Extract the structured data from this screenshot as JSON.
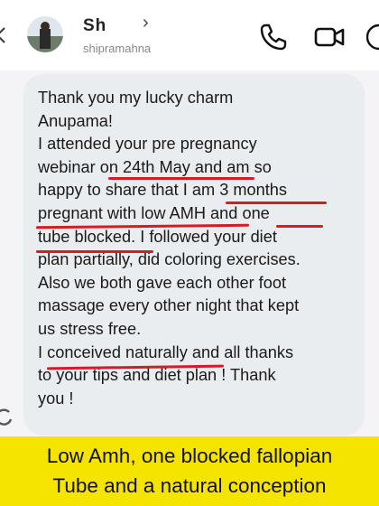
{
  "header": {
    "contact_name": "Sh   ",
    "contact_sub": "shipramahna",
    "chevron": "›",
    "icons": [
      "back-arrow-icon",
      "phone-icon",
      "video-call-icon",
      "more-icon"
    ]
  },
  "message": {
    "lines": [
      "Thank you my lucky charm",
      "Anupama!",
      "I attended your pre pregnancy",
      "webinar on 24th May and am so",
      "happy to share that I am 3 months",
      "pregnant with low AMH and one",
      "tube blocked. I followed your diet",
      "plan partially, did coloring exercises.",
      "Also we both gave each other foot",
      "massage every other night that kept",
      "us stress free.",
      "I conceived naturally and all thanks",
      "to your tips and diet plan ! Thank",
      "you !"
    ],
    "highlight_color": "#d51c24"
  },
  "banner": {
    "line1": "Low Amh, one blocked fallopian",
    "line2": "Tube and a natural conception",
    "color": "#f5e300"
  }
}
